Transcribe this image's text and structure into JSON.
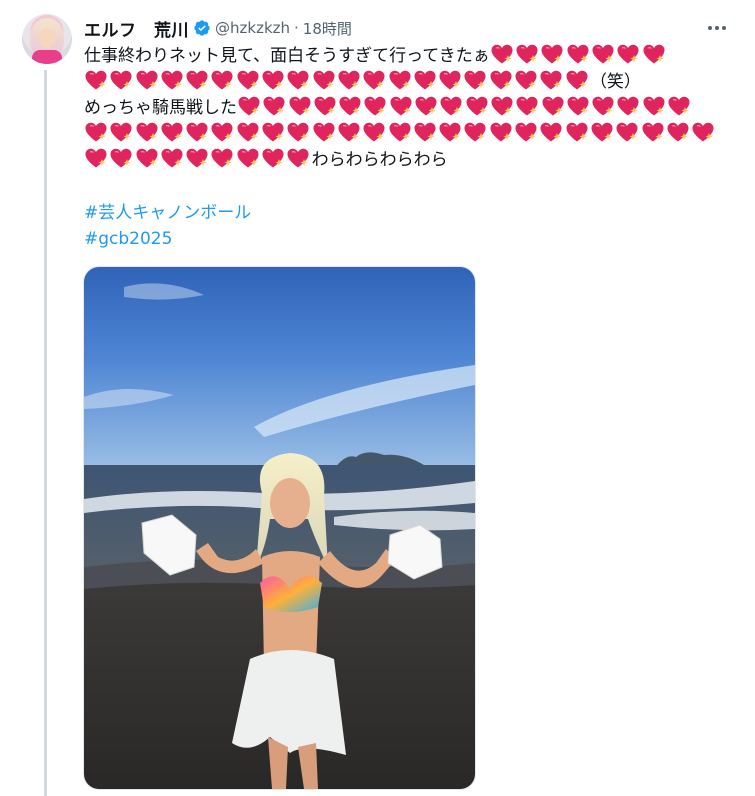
{
  "tweet": {
    "author": {
      "display_name": "エルフ　荒川",
      "handle": "@hzkzkzh",
      "verified": true,
      "avatar_icon": "avatar-photo"
    },
    "separator": "·",
    "time": "18時間",
    "more_icon": "more-horizontal-icon",
    "text": {
      "line1": "仕事終わりネット見て、面白そうすぎて行ってきたぁ",
      "line2_suffix": "（笑）",
      "line3": "めっちゃ騎馬戦した",
      "line5_suffix": "わらわらわらわら"
    },
    "heart_emoji": "sparkling-heart",
    "heart_counts": {
      "line1": 7,
      "line2": 20,
      "line3": 18,
      "line4": 25,
      "line5": 9
    },
    "hashtags": [
      "#芸人キャノンボール",
      "#gcb2025"
    ],
    "media": {
      "alt": "photo-woman-on-beach-with-white-gloves"
    }
  },
  "colors": {
    "text": "#0f1419",
    "secondary": "#536471",
    "link": "#1d9bf0",
    "verified": "#1d9bf0",
    "heart": "#e0245e",
    "sparkle": "#ffcc4d",
    "thread_line": "#cfd9de"
  }
}
